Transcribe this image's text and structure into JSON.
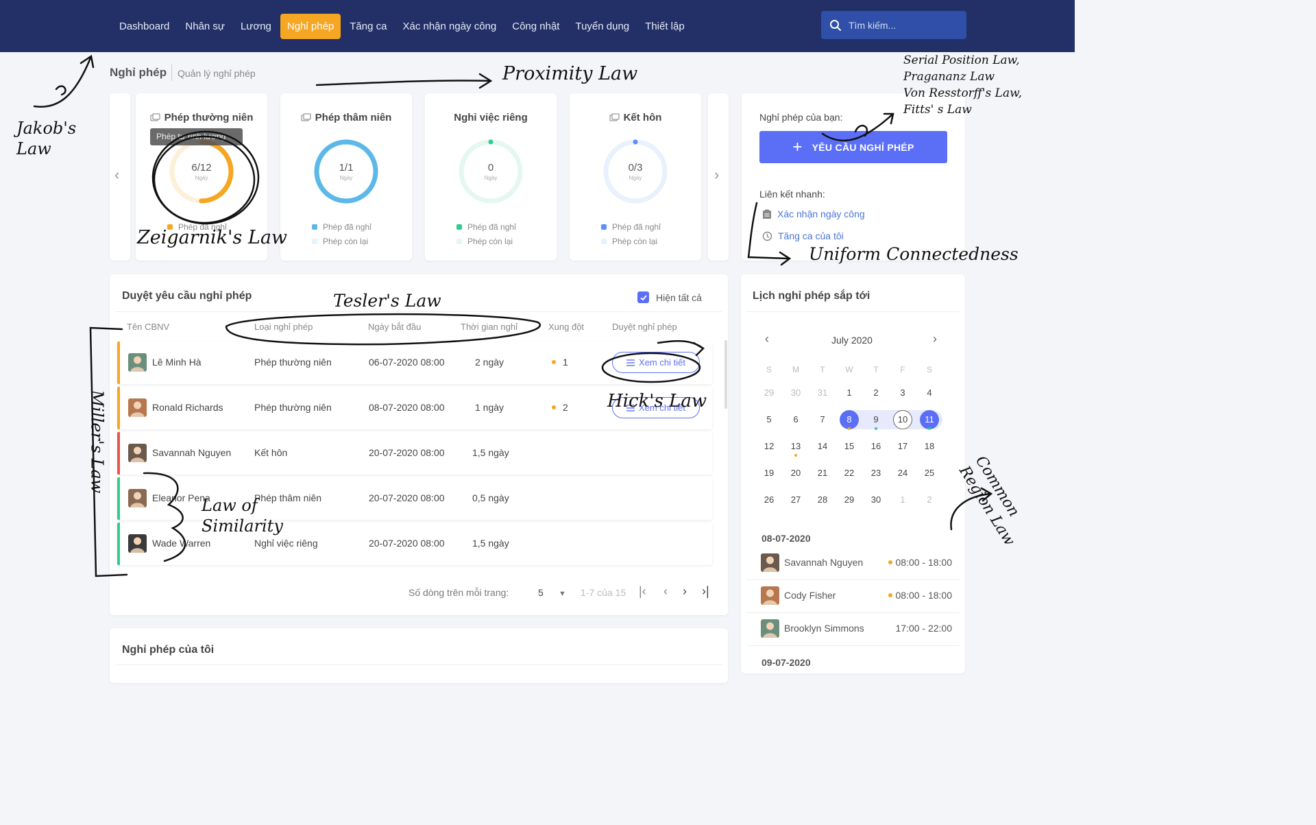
{
  "nav": {
    "items": [
      {
        "label": "Dashboard",
        "active": false
      },
      {
        "label": "Nhân sự",
        "active": false
      },
      {
        "label": "Lương",
        "active": false
      },
      {
        "label": "Nghỉ phép",
        "active": true
      },
      {
        "label": "Tăng ca",
        "active": false
      },
      {
        "label": "Xác nhận ngày công",
        "active": false
      },
      {
        "label": "Công nhật",
        "active": false
      },
      {
        "label": "Tuyển dụng",
        "active": false
      },
      {
        "label": "Thiết lập",
        "active": false
      }
    ],
    "search_placeholder": "Tìm kiếm..."
  },
  "page": {
    "title": "Nghỉ phép",
    "subtitle": "Quản lý nghỉ phép"
  },
  "leave_cards": [
    {
      "title": "Phép thường niên",
      "value": "6/12",
      "unit": "Ngày",
      "used": 6,
      "total": 12,
      "color": "#f5a623",
      "light": "#fdf0d8",
      "legend_used": "Phép đã nghỉ",
      "legend_left": "",
      "tooltip": "Phép tự tính lương"
    },
    {
      "title": "Phép thâm niên",
      "value": "1/1",
      "unit": "Ngày",
      "used": 1,
      "total": 1,
      "color": "#5bb8e8",
      "light": "#e6f4fb",
      "legend_used": "Phép đã nghỉ",
      "legend_left": "Phép còn lại"
    },
    {
      "title": "Nghỉ việc riêng",
      "value": "0",
      "unit": "Ngày",
      "used": 0,
      "total": 1,
      "color": "#2ecc8f",
      "light": "#e4f8f0",
      "legend_used": "Phép đã nghỉ",
      "legend_left": "Phép còn lại"
    },
    {
      "title": "Kết hôn",
      "value": "0/3",
      "unit": "Ngày",
      "used": 0,
      "total": 3,
      "color": "#5b8ff6",
      "light": "#e8f1fd",
      "legend_used": "Phép đã nghỉ",
      "legend_left": "Phép còn lại"
    }
  ],
  "request_panel": {
    "label": "Nghỉ phép của bạn:",
    "button": "YÊU CẦU NGHỈ PHÉP",
    "quick_links_label": "Liên kết nhanh:",
    "links": [
      "Xác nhận ngày công",
      "Tăng ca của tôi"
    ]
  },
  "approvals": {
    "title": "Duyệt yêu cầu nghỉ phép",
    "show_all_label": "Hiện tất cả",
    "columns": [
      "Tên CBNV",
      "Loại nghỉ phép",
      "Ngày bắt đầu",
      "Thời gian nghỉ",
      "Xung đột",
      "Duyệt nghỉ phép"
    ],
    "rows": [
      {
        "name": "Lê Minh Hà",
        "type": "Phép thường niên",
        "start": "06-07-2020 08:00",
        "duration": "2 ngày",
        "conflict": "1",
        "action": "Xem chi tiết",
        "color": "#f5a623"
      },
      {
        "name": "Ronald Richards",
        "type": "Phép thường niên",
        "start": "08-07-2020 08:00",
        "duration": "1 ngày",
        "conflict": "2",
        "action": "Xem chi tiết",
        "color": "#f5a623"
      },
      {
        "name": "Savannah Nguyen",
        "type": "Kết hôn",
        "start": "20-07-2020 08:00",
        "duration": "1,5 ngày",
        "conflict": "",
        "action": "",
        "color": "#e8534c"
      },
      {
        "name": "Eleanor Pena",
        "type": "Phép thâm niên",
        "start": "20-07-2020 08:00",
        "duration": "0,5 ngày",
        "conflict": "",
        "action": "",
        "color": "#2ecc8f"
      },
      {
        "name": "Wade Warren",
        "type": "Nghỉ việc riêng",
        "start": "20-07-2020 08:00",
        "duration": "1,5 ngày",
        "conflict": "",
        "action": "",
        "color": "#2ecc8f"
      }
    ],
    "pagination": {
      "rows_label": "Số dòng trên mỗi trang:",
      "rows_value": "5",
      "range": "1-7 của 15"
    }
  },
  "calendar": {
    "title": "Lịch nghỉ phép sắp tới",
    "month": "July 2020",
    "dow": [
      "S",
      "M",
      "T",
      "W",
      "T",
      "F",
      "S"
    ],
    "weeks": [
      [
        "29",
        "30",
        "31",
        "1",
        "2",
        "3",
        "4"
      ],
      [
        "5",
        "6",
        "7",
        "8",
        "9",
        "10",
        "11"
      ],
      [
        "12",
        "13",
        "14",
        "15",
        "16",
        "17",
        "18"
      ],
      [
        "19",
        "20",
        "21",
        "22",
        "23",
        "24",
        "25"
      ],
      [
        "26",
        "27",
        "28",
        "29",
        "30",
        "1",
        "2"
      ]
    ],
    "groups": [
      {
        "date": "08-07-2020",
        "events": [
          {
            "name": "Savannah Nguyen",
            "time": "08:00 - 18:00",
            "dot": true
          },
          {
            "name": "Cody Fisher",
            "time": "08:00 - 18:00",
            "dot": true
          },
          {
            "name": "Brooklyn Simmons",
            "time": "17:00 - 22:00",
            "dot": false
          }
        ]
      },
      {
        "date": "09-07-2020",
        "events": []
      }
    ]
  },
  "my_leave": {
    "title": "Nghỉ phép của tôi"
  },
  "annotations": {
    "jakob": "Jakob's\nLaw",
    "proximity": "Proximity Law",
    "serial": "Serial Position Law,\nPragananz Law\nVon Resstorff's Law,\nFitts' s Law",
    "zeigarnik": "Zeigarnik's Law",
    "tesler": "Tesler's Law",
    "uniform": "Uniform Connectedness",
    "hick": "Hick's Law",
    "miller": "Miller's Law",
    "similarity": "Law of\nSimilarity",
    "common": "Common\nRegion Law"
  },
  "colors": {
    "nav_bg": "#223067",
    "accent": "#5b6ff6",
    "active_tab": "#f5a623"
  }
}
